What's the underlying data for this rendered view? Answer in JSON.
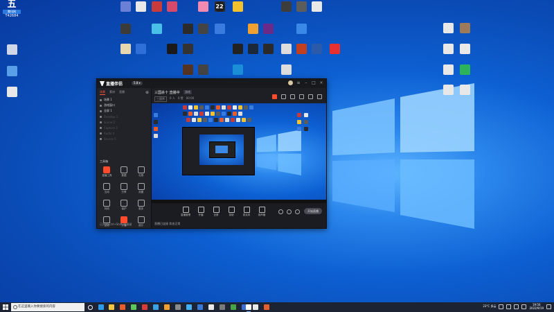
{
  "desktop": {
    "corner_logo": {
      "text": "五",
      "sub": "腾讯网",
      "num": "T42684"
    },
    "icons_top_row": [
      {
        "label": "",
        "color": "#6a7fd6"
      },
      {
        "label": "",
        "color": "#e8e8e8"
      },
      {
        "label": "",
        "color": "#c73b3b"
      },
      {
        "label": "",
        "color": "#d54a6a"
      },
      {
        "label": "",
        "color": "#f08ab0"
      },
      {
        "label": "",
        "color": "#2d2d2d"
      },
      {
        "label": "",
        "color": "#f2c12e"
      },
      {
        "label": "",
        "color": "#3d3d3d"
      },
      {
        "label": "",
        "color": "#5c5c5c"
      },
      {
        "label": "",
        "color": "#e8e8e8"
      }
    ],
    "tile_22": "22",
    "right_icons": [
      {
        "label": "",
        "color": "#e8e8e8"
      },
      {
        "label": "",
        "color": "#9c7a5a"
      },
      {
        "label": "",
        "color": "#e8e8e8"
      },
      {
        "label": "",
        "color": "#e8e8e8"
      },
      {
        "label": "",
        "color": "#e8e8e8"
      },
      {
        "label": "",
        "color": "#2db35a"
      },
      {
        "label": "",
        "color": "#e8e8e8"
      },
      {
        "label": "",
        "color": "#e8e8e8"
      }
    ]
  },
  "app": {
    "name": "直播伴侣",
    "version": "5.8 ▾",
    "left_tabs": [
      "场景",
      "素材",
      "直播"
    ],
    "scenes": [
      {
        "label": "场景 1"
      },
      {
        "label": "游戏窗口"
      },
      {
        "label": "全屏 1"
      },
      {
        "label": "Desktop 1"
      },
      {
        "label": "Scene 2"
      },
      {
        "label": "Capture 3"
      },
      {
        "label": "Audio 4"
      },
      {
        "label": "Source 5"
      }
    ],
    "tools_title": "工具箱",
    "tools": [
      {
        "label": "直播工具",
        "hot": true
      },
      {
        "label": "数据"
      },
      {
        "label": "礼物"
      },
      {
        "label": "互动"
      },
      {
        "label": "分享"
      },
      {
        "label": "设置"
      },
      {
        "label": "特效"
      },
      {
        "label": "保护"
      },
      {
        "label": "更多"
      },
      {
        "label": "反馈"
      },
      {
        "label": "开播",
        "hot": true
      },
      {
        "label": "统计"
      }
    ],
    "footer": "已开启 Ctrl+Shift 快捷键",
    "room_title": "三国杀十 直播中",
    "room_tag": "游戏",
    "room_meta": [
      "三国杀",
      "0 人",
      "0 赞",
      "00:00"
    ],
    "bottom_tools": [
      {
        "label": "直播管理"
      },
      {
        "label": "开播"
      },
      {
        "label": "全屏"
      },
      {
        "label": "录制"
      },
      {
        "label": "麦克风"
      },
      {
        "label": "扬声器"
      }
    ],
    "start_live": "开始直播",
    "status": "直播已连接 状态正常"
  },
  "taskbar": {
    "search_placeholder": "在这里输入你要搜索的内容",
    "apps": [
      {
        "name": "task-view",
        "color": "#ffffff"
      },
      {
        "name": "edge",
        "color": "#2d9be8"
      },
      {
        "name": "explorer",
        "color": "#f4c542"
      },
      {
        "name": "app-1",
        "color": "#e85d2a"
      },
      {
        "name": "app-2",
        "color": "#5cc85c"
      },
      {
        "name": "app-3",
        "color": "#d83b3b"
      },
      {
        "name": "app-4",
        "color": "#3aa0e8"
      },
      {
        "name": "app-5",
        "color": "#f0a030"
      },
      {
        "name": "app-6",
        "color": "#8a8a8a"
      },
      {
        "name": "app-7",
        "color": "#42b0f5"
      },
      {
        "name": "app-8",
        "color": "#3a78d8"
      },
      {
        "name": "app-9",
        "color": "#e8e8e8"
      },
      {
        "name": "app-10",
        "color": "#7a7a7a"
      },
      {
        "name": "xbox",
        "color": "#47a447"
      },
      {
        "name": "app-12",
        "color": "#3b6fd8"
      },
      {
        "name": "app-13",
        "color": "#e8e8e8"
      },
      {
        "name": "app-14",
        "color": "#e06030"
      },
      {
        "name": "live-companion",
        "color": "#ffffff"
      }
    ],
    "weather": "23°C 多云",
    "time": "19:56",
    "date": "2022/9/19"
  }
}
